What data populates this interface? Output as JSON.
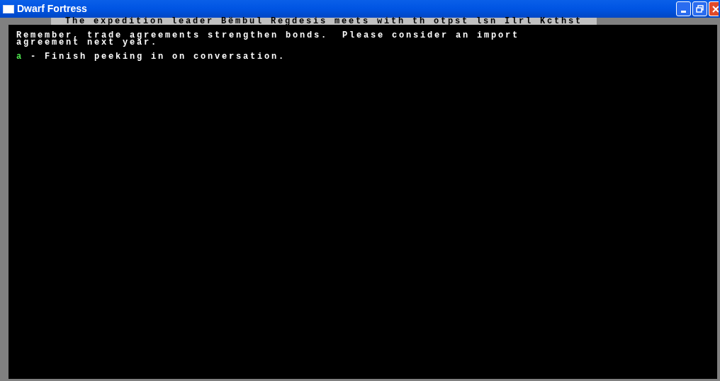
{
  "window": {
    "title": "Dwarf Fortress"
  },
  "header": "The expedition leader Bëmbul Regdesis meets with th otpst lsn Ilrl Kcthst",
  "message": [
    "Remember, trade agreements strengthen bonds.  Please consider an import",
    "agreement next year."
  ],
  "options": [
    {
      "key": "a",
      "label": " - Finish peeking in on conversation."
    }
  ]
}
